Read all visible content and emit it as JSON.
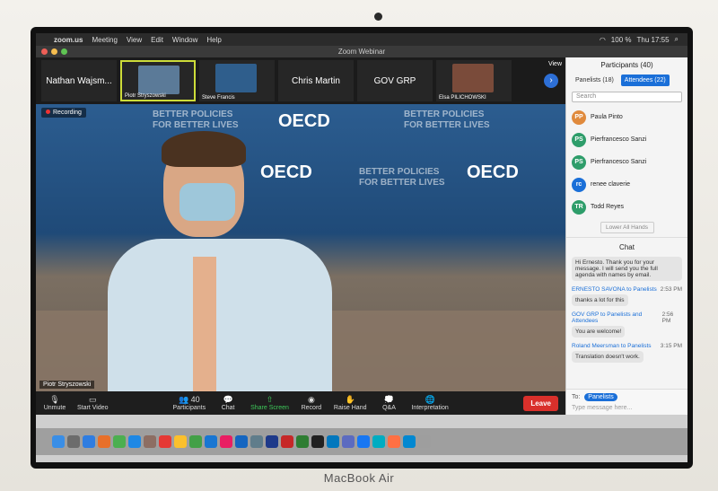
{
  "menubar": {
    "app": "zoom.us",
    "items": [
      "Meeting",
      "View",
      "Edit",
      "Window",
      "Help"
    ],
    "battery": "100 %",
    "clock": "Thu 17:55"
  },
  "window": {
    "title": "Zoom Webinar"
  },
  "thumbs": [
    {
      "label": "Nathan Wajsm..."
    },
    {
      "label": "Piotr Stryszowski"
    },
    {
      "label": "Steve Francis"
    },
    {
      "label": "Chris Martin"
    },
    {
      "label": "GOV GRP"
    },
    {
      "label": "Elsa PILICHOWSKI"
    }
  ],
  "view_label": "View",
  "main": {
    "recording": "Recording",
    "speaker": "Piotr Stryszowski",
    "bg_text": [
      "BETTER POLICIES",
      "FOR BETTER LIVES",
      "OECD"
    ]
  },
  "toolbar": {
    "unmute": "Unmute",
    "start_video": "Start Video",
    "participants": "Participants",
    "participants_count": "40",
    "chat": "Chat",
    "share": "Share Screen",
    "record": "Record",
    "raise": "Raise Hand",
    "qa": "Q&A",
    "interp": "Interpretation",
    "leave": "Leave"
  },
  "panel": {
    "title": "Participants (40)",
    "tab_panelists": "Panelists (18)",
    "tab_attendees": "Attendees (22)",
    "search": "Search",
    "people": [
      {
        "initials": "PP",
        "name": "Paula Pinto",
        "color": "#e08a3c"
      },
      {
        "initials": "PS",
        "name": "Pierfrancesco Sanzi",
        "color": "#2e9d6a"
      },
      {
        "initials": "PS",
        "name": "Pierfrancesco Sanzi",
        "color": "#2e9d6a"
      },
      {
        "initials": "rc",
        "name": "renee claverie",
        "color": "#1a6fd8"
      },
      {
        "initials": "TR",
        "name": "Todd Reyes",
        "color": "#2e9d6a"
      }
    ],
    "lower_all": "Lower All Hands",
    "chat_title": "Chat",
    "messages": [
      {
        "text": "Hi Ernesto. Thank you for your message. I will send you the full agenda with names by email."
      },
      {
        "from": "ERNESTO SAVONA to Panelists",
        "time": "2:53 PM",
        "text": "thanks a lot for this"
      },
      {
        "from": "GOV GRP to Panelists and Attendees",
        "time": "2:56 PM",
        "text": "You are welcome!"
      },
      {
        "from": "Roland Meersman to Panelists",
        "time": "3:15 PM",
        "text": "Translation doesn't work."
      }
    ],
    "to_label": "To:",
    "to_value": "Panelists",
    "message_placeholder": "Type message here..."
  },
  "brand": "MacBook Air"
}
